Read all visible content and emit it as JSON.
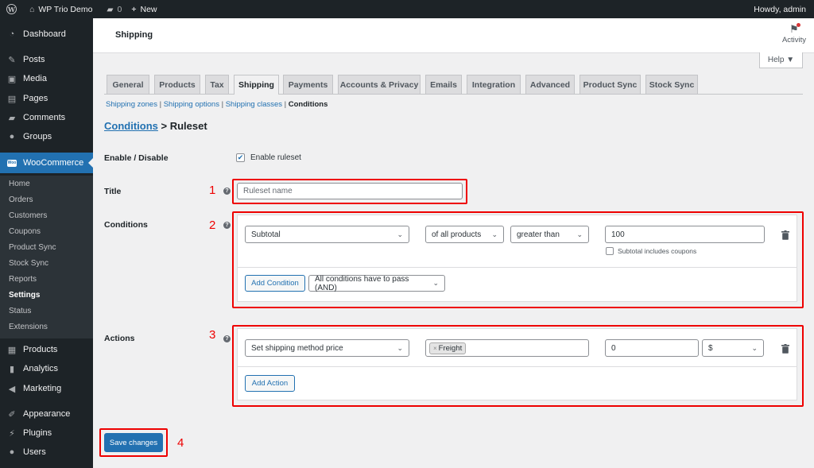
{
  "adminbar": {
    "site_name": "WP Trio Demo",
    "comments_count": "0",
    "new_label": "New",
    "howdy": "Howdy, admin"
  },
  "sidebar": {
    "items": [
      {
        "label": "Dashboard",
        "icon": "dashboard-icon"
      },
      {
        "label": "Posts",
        "icon": "pin-icon"
      },
      {
        "label": "Media",
        "icon": "media-icon"
      },
      {
        "label": "Pages",
        "icon": "pages-icon"
      },
      {
        "label": "Comments",
        "icon": "comment-icon"
      },
      {
        "label": "Groups",
        "icon": "groups-icon"
      },
      {
        "label": "WooCommerce",
        "icon": "woo-icon"
      },
      {
        "label": "Products",
        "icon": "products-icon"
      },
      {
        "label": "Analytics",
        "icon": "analytics-icon"
      },
      {
        "label": "Marketing",
        "icon": "megaphone-icon"
      },
      {
        "label": "Appearance",
        "icon": "brush-icon"
      },
      {
        "label": "Plugins",
        "icon": "plug-icon"
      },
      {
        "label": "Users",
        "icon": "user-icon"
      }
    ],
    "woo_submenu": [
      "Home",
      "Orders",
      "Customers",
      "Coupons",
      "Product Sync",
      "Stock Sync",
      "Reports",
      "Settings",
      "Status",
      "Extensions"
    ],
    "woo_badge": "Woo"
  },
  "header": {
    "title": "Shipping",
    "activity_label": "Activity",
    "help_label": "Help ▼"
  },
  "tabs": [
    "General",
    "Products",
    "Tax",
    "Shipping",
    "Payments",
    "Accounts & Privacy",
    "Emails",
    "Integration",
    "Advanced",
    "Product Sync",
    "Stock Sync"
  ],
  "subsub": {
    "zones": "Shipping zones",
    "options": "Shipping options",
    "classes": "Shipping classes",
    "current": "Conditions"
  },
  "heading": {
    "link": "Conditions",
    "rest": " > Ruleset"
  },
  "form": {
    "enable_label": "Enable / Disable",
    "enable_checkbox_label": "Enable ruleset",
    "title_label": "Title",
    "title_placeholder": "Ruleset name",
    "conditions_label": "Conditions",
    "condition": {
      "field": "Subtotal",
      "scope": "of all products",
      "operator": "greater than",
      "value": "100",
      "coupons_label": "Subtotal includes coupons"
    },
    "add_condition": "Add Condition",
    "conditions_mode": "All conditions have to pass (AND)",
    "actions_label": "Actions",
    "action": {
      "type": "Set shipping method price",
      "method_tag": "Freight",
      "price": "0",
      "currency": "$"
    },
    "add_action": "Add Action",
    "save": "Save changes"
  },
  "annotations": [
    "1",
    "2",
    "3",
    "4"
  ],
  "colors": {
    "accent": "#2271b1",
    "sidebar": "#1d2327",
    "highlight": "#e00000"
  }
}
